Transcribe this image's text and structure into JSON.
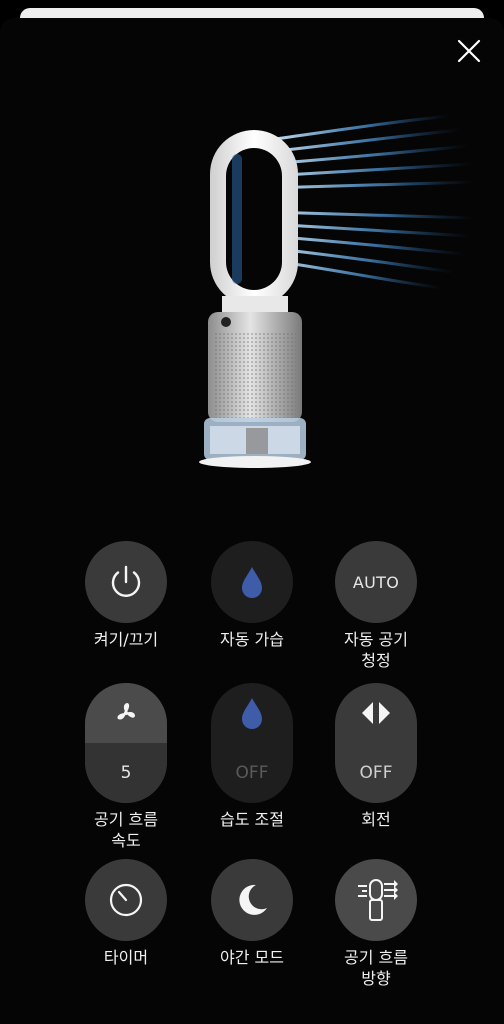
{
  "colors": {
    "background": "#000000",
    "button": "#3a3a3a",
    "button_inactive": "#1e1e1e",
    "water_drop": "#3f5ca8",
    "airflow": "#6fb8ff"
  },
  "hero": {
    "icon": "air-purifier-humidifier-image"
  },
  "controls": {
    "power": {
      "label": "켜기/끄기",
      "icon": "power-icon"
    },
    "auto_humidify": {
      "label": "자동 가습",
      "icon": "water-drop-icon"
    },
    "auto_purify": {
      "label": "자동 공기\n청정",
      "value": "AUTO"
    },
    "fan_speed": {
      "label": "공기 흐름\n속도",
      "value": "5",
      "icon": "fan-icon"
    },
    "humidity": {
      "label": "습도 조절",
      "value": "OFF",
      "icon": "water-drop-icon"
    },
    "oscillation": {
      "label": "회전",
      "value": "OFF",
      "icon": "oscillation-icon"
    },
    "timer": {
      "label": "타이머",
      "icon": "timer-icon"
    },
    "night_mode": {
      "label": "야간 모드",
      "icon": "moon-icon"
    },
    "airflow_direction": {
      "label": "공기 흐름\n방향",
      "icon": "airflow-direction-icon"
    }
  }
}
